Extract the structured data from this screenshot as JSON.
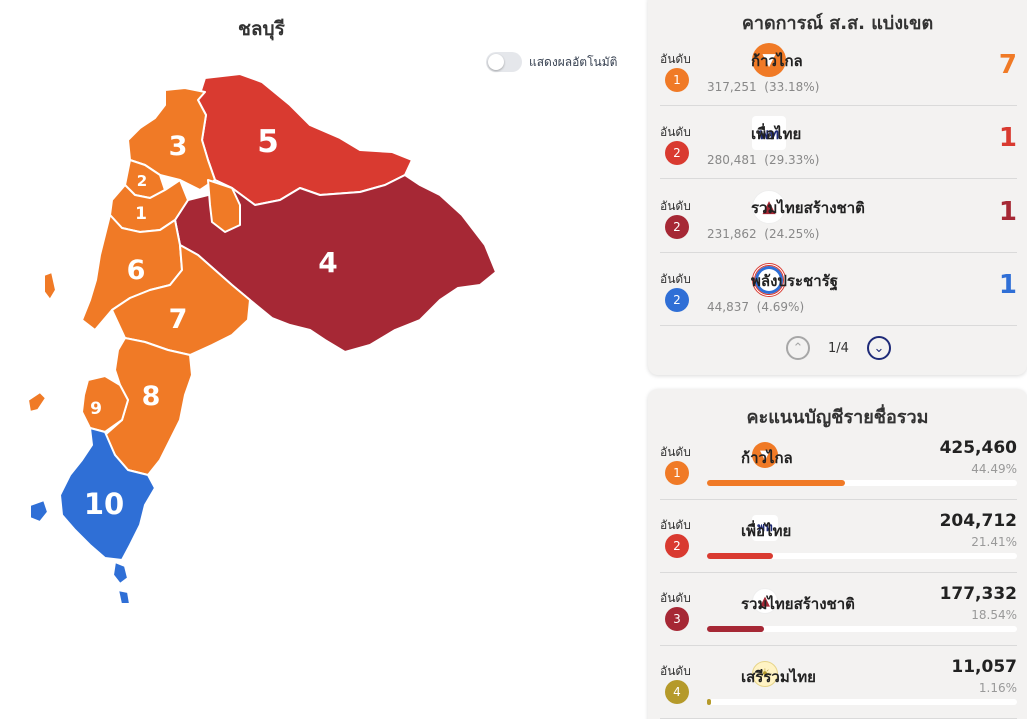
{
  "map": {
    "title": "ชลบุรี",
    "toggle_label": "แสดงผลอัตโนมัติ",
    "districts": [
      {
        "label": "1",
        "color": "#f07a26"
      },
      {
        "label": "2",
        "color": "#f07a26"
      },
      {
        "label": "3",
        "color": "#f07a26"
      },
      {
        "label": "4",
        "color": "#a62835"
      },
      {
        "label": "5",
        "color": "#d93a30"
      },
      {
        "label": "6",
        "color": "#f07a26"
      },
      {
        "label": "7",
        "color": "#f07a26"
      },
      {
        "label": "8",
        "color": "#f07a26"
      },
      {
        "label": "9",
        "color": "#f07a26"
      },
      {
        "label": "10",
        "color": "#2f6fd6"
      }
    ]
  },
  "forecast": {
    "title": "คาดการณ์ ส.ส. แบ่งเขต",
    "rank_label": "อันดับ",
    "rows": [
      {
        "rank": "1",
        "rank_color": "#f07a26",
        "party": "ก้าวไกล",
        "logo": "move-forward-logo",
        "votes": "317,251",
        "pct": "(33.18%)",
        "seats": "7",
        "seat_color": "#f07a26"
      },
      {
        "rank": "2",
        "rank_color": "#d93a30",
        "party": "เพื่อไทย",
        "logo": "pheu-thai-logo",
        "votes": "280,481",
        "pct": "(29.33%)",
        "seats": "1",
        "seat_color": "#d93a30"
      },
      {
        "rank": "2",
        "rank_color": "#a62835",
        "party": "รวมไทยสร้างชาติ",
        "logo": "utn-logo",
        "votes": "231,862",
        "pct": "(24.25%)",
        "seats": "1",
        "seat_color": "#a62835"
      },
      {
        "rank": "2",
        "rank_color": "#2f6fd6",
        "party": "พลังประชารัฐ",
        "logo": "pprp-logo",
        "votes": "44,837",
        "pct": "(4.69%)",
        "seats": "1",
        "seat_color": "#2f6fd6"
      }
    ],
    "pager": "1/4"
  },
  "partylist": {
    "title": "คะแนนบัญชีรายชื่อรวม",
    "rank_label": "อันดับ",
    "rows": [
      {
        "rank": "1",
        "rank_color": "#f07a26",
        "party": "ก้าวไกล",
        "logo": "move-forward-logo",
        "votes": "425,460",
        "pct": "44.49%",
        "share": 0.4449,
        "bar_color": "#f07a26"
      },
      {
        "rank": "2",
        "rank_color": "#d93a30",
        "party": "เพื่อไทย",
        "logo": "pheu-thai-logo",
        "votes": "204,712",
        "pct": "21.41%",
        "share": 0.2141,
        "bar_color": "#d93a30"
      },
      {
        "rank": "3",
        "rank_color": "#a62835",
        "party": "รวมไทยสร้างชาติ",
        "logo": "utn-logo",
        "votes": "177,332",
        "pct": "18.54%",
        "share": 0.1854,
        "bar_color": "#a62835"
      },
      {
        "rank": "4",
        "rank_color": "#b59a2a",
        "party": "เสรีรวมไทย",
        "logo": "seri-ruam-thai-logo",
        "votes": "11,057",
        "pct": "1.16%",
        "share": 0.0116,
        "bar_color": "#b59a2a"
      }
    ]
  }
}
